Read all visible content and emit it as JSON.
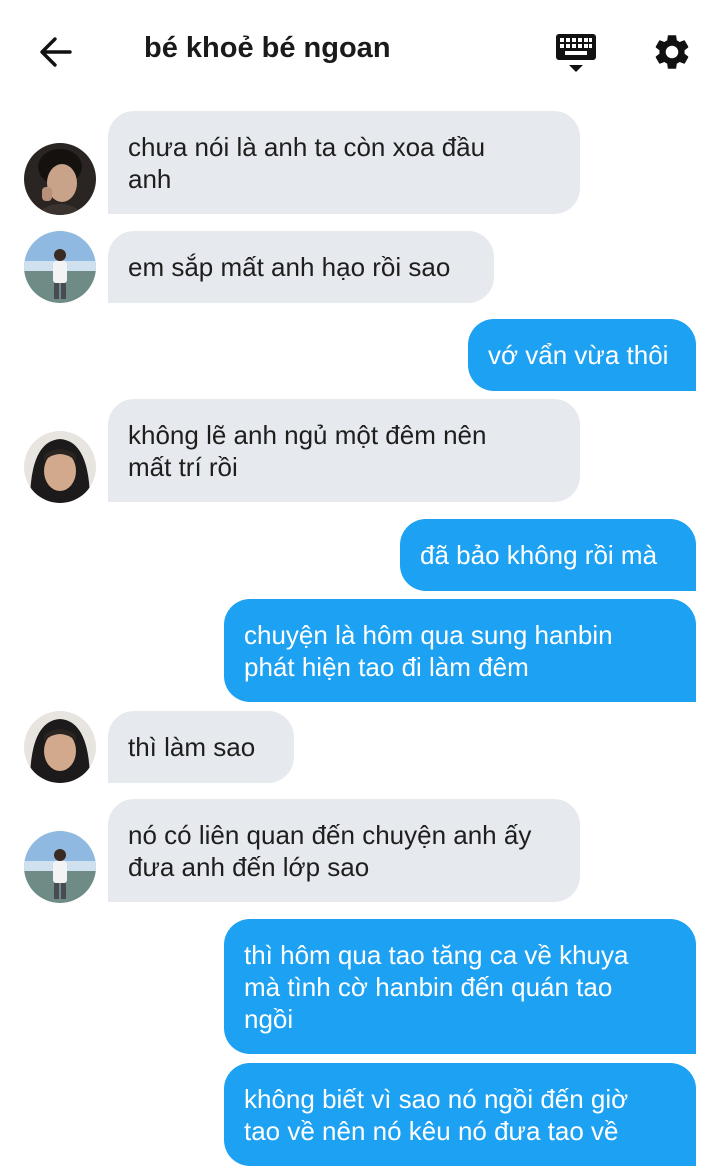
{
  "header": {
    "title": "bé khoẻ bé ngoan",
    "back_icon": "arrow-left-icon",
    "keyboard_icon": "keyboard-icon",
    "settings_icon": "gear-icon"
  },
  "colors": {
    "sent_bubble": "#1da1f2",
    "received_bubble": "#e6e9ed",
    "text_dark": "#1e1e1e"
  },
  "messages": [
    {
      "side": "received",
      "text": "chưa nói là anh ta còn xoa đầu\nanh"
    },
    {
      "side": "received",
      "text": "em sắp mất anh hạo rồi sao"
    },
    {
      "side": "sent",
      "text": "vớ vẩn vừa thôi"
    },
    {
      "side": "received",
      "text": "không lẽ anh ngủ một đêm nên\nmất trí rồi"
    },
    {
      "side": "sent",
      "text": "đã bảo không rồi mà"
    },
    {
      "side": "sent",
      "text": "chuyện là hôm qua sung hanbin\nphát hiện tao đi làm đêm"
    },
    {
      "side": "received",
      "text": "thì làm sao"
    },
    {
      "side": "received",
      "text": "nó có liên quan đến chuyện anh ấy\nđưa anh đến lớp sao"
    },
    {
      "side": "sent",
      "text": "thì hôm qua tao tăng ca về khuya\nmà tình cờ hanbin đến quán tao\nngồi"
    },
    {
      "side": "sent",
      "text": "không biết vì sao nó ngồi đến giờ\ntao về nên nó kêu nó đưa tao về"
    }
  ]
}
